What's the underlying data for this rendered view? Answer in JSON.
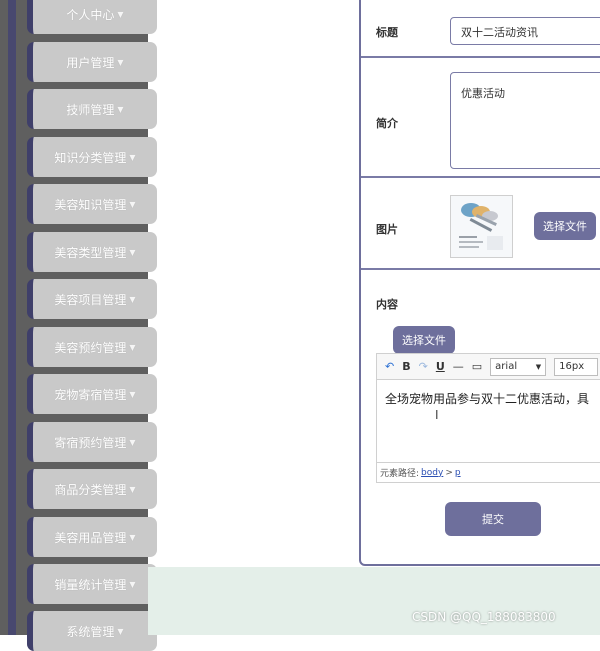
{
  "sidebar": {
    "items": [
      {
        "label": "个人中心"
      },
      {
        "label": "用户管理"
      },
      {
        "label": "技师管理"
      },
      {
        "label": "知识分类管理"
      },
      {
        "label": "美容知识管理"
      },
      {
        "label": "美容类型管理"
      },
      {
        "label": "美容项目管理"
      },
      {
        "label": "美容预约管理"
      },
      {
        "label": "宠物寄宿管理"
      },
      {
        "label": "寄宿预约管理"
      },
      {
        "label": "商品分类管理"
      },
      {
        "label": "美容用品管理"
      },
      {
        "label": "销量统计管理"
      },
      {
        "label": "系统管理"
      }
    ]
  },
  "form": {
    "title_label": "标题",
    "title_value": "双十二活动资讯",
    "intro_label": "简介",
    "intro_value": "优惠活动",
    "image_label": "图片",
    "choose_file": "选择文件",
    "content_label": "内容",
    "content_choose_file": "选择文件",
    "submit": "提交"
  },
  "editor": {
    "toolbar": {
      "bold": "B",
      "underline": "U",
      "font_family": "arial",
      "font_size": "16px"
    },
    "content_text": "全场宠物用品参与双十二优惠活动，具",
    "path_label": "元素路径:",
    "path_body": "body",
    "path_sep": ">",
    "path_p": "p"
  },
  "watermark": "CSDN @QQ_188083800"
}
